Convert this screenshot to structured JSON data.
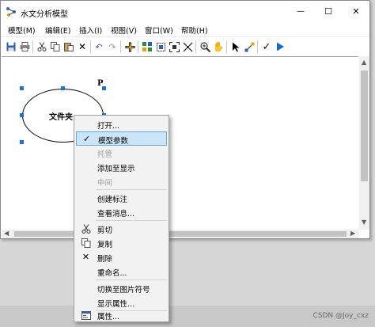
{
  "window": {
    "title": "水文分析模型"
  },
  "titlebar": {
    "minimize_glyph": "—",
    "maximize_glyph": "☐",
    "close_glyph": "✕"
  },
  "menubar": [
    {
      "label": "模型(M)"
    },
    {
      "label": "编辑(E)"
    },
    {
      "label": "插入(I)"
    },
    {
      "label": "视图(V)"
    },
    {
      "label": "窗口(W)"
    },
    {
      "label": "帮助(H)"
    }
  ],
  "toolbar": [
    "save-icon",
    "print-icon",
    "cut-icon",
    "copy-icon",
    "paste-icon",
    "delete-icon",
    "undo-icon",
    "redo-icon",
    "add-data-icon",
    "auto-layout-icon",
    "select-all-icon",
    "full-extent-icon",
    "fixed-zoom-icon",
    "zoom-in-icon",
    "pan-icon",
    "select-pointer-icon",
    "connect-icon",
    "validate-icon",
    "run-icon"
  ],
  "model": {
    "element_label": "文件夹",
    "parameter_marker": "P"
  },
  "context_menu": {
    "items": [
      {
        "label": "打开...",
        "enabled": true
      },
      {
        "label": "模型参数",
        "enabled": true,
        "checked": true
      },
      {
        "label": "托管",
        "enabled": false
      },
      {
        "label": "添加至显示",
        "enabled": true
      },
      {
        "label": "中间",
        "enabled": false
      },
      {
        "label": "创建标注",
        "enabled": true
      },
      {
        "label": "查看消息...",
        "enabled": true
      },
      {
        "label": "剪切",
        "enabled": true,
        "icon": "scissors-icon"
      },
      {
        "label": "复制",
        "enabled": true,
        "icon": "copy-icon"
      },
      {
        "label": "删除",
        "enabled": true,
        "icon": "delete-icon"
      },
      {
        "label": "重命名...",
        "enabled": true
      },
      {
        "label": "切换至图片符号",
        "enabled": true
      },
      {
        "label": "显示属性...",
        "enabled": true
      },
      {
        "label": "属性...",
        "enabled": true,
        "icon": "properties-icon"
      }
    ]
  },
  "watermark": "CSDN @Joy_cxz",
  "colors": {
    "selection": "#cce4f7",
    "selection_border": "#62a8e0",
    "grip": "#1f6fd8"
  }
}
